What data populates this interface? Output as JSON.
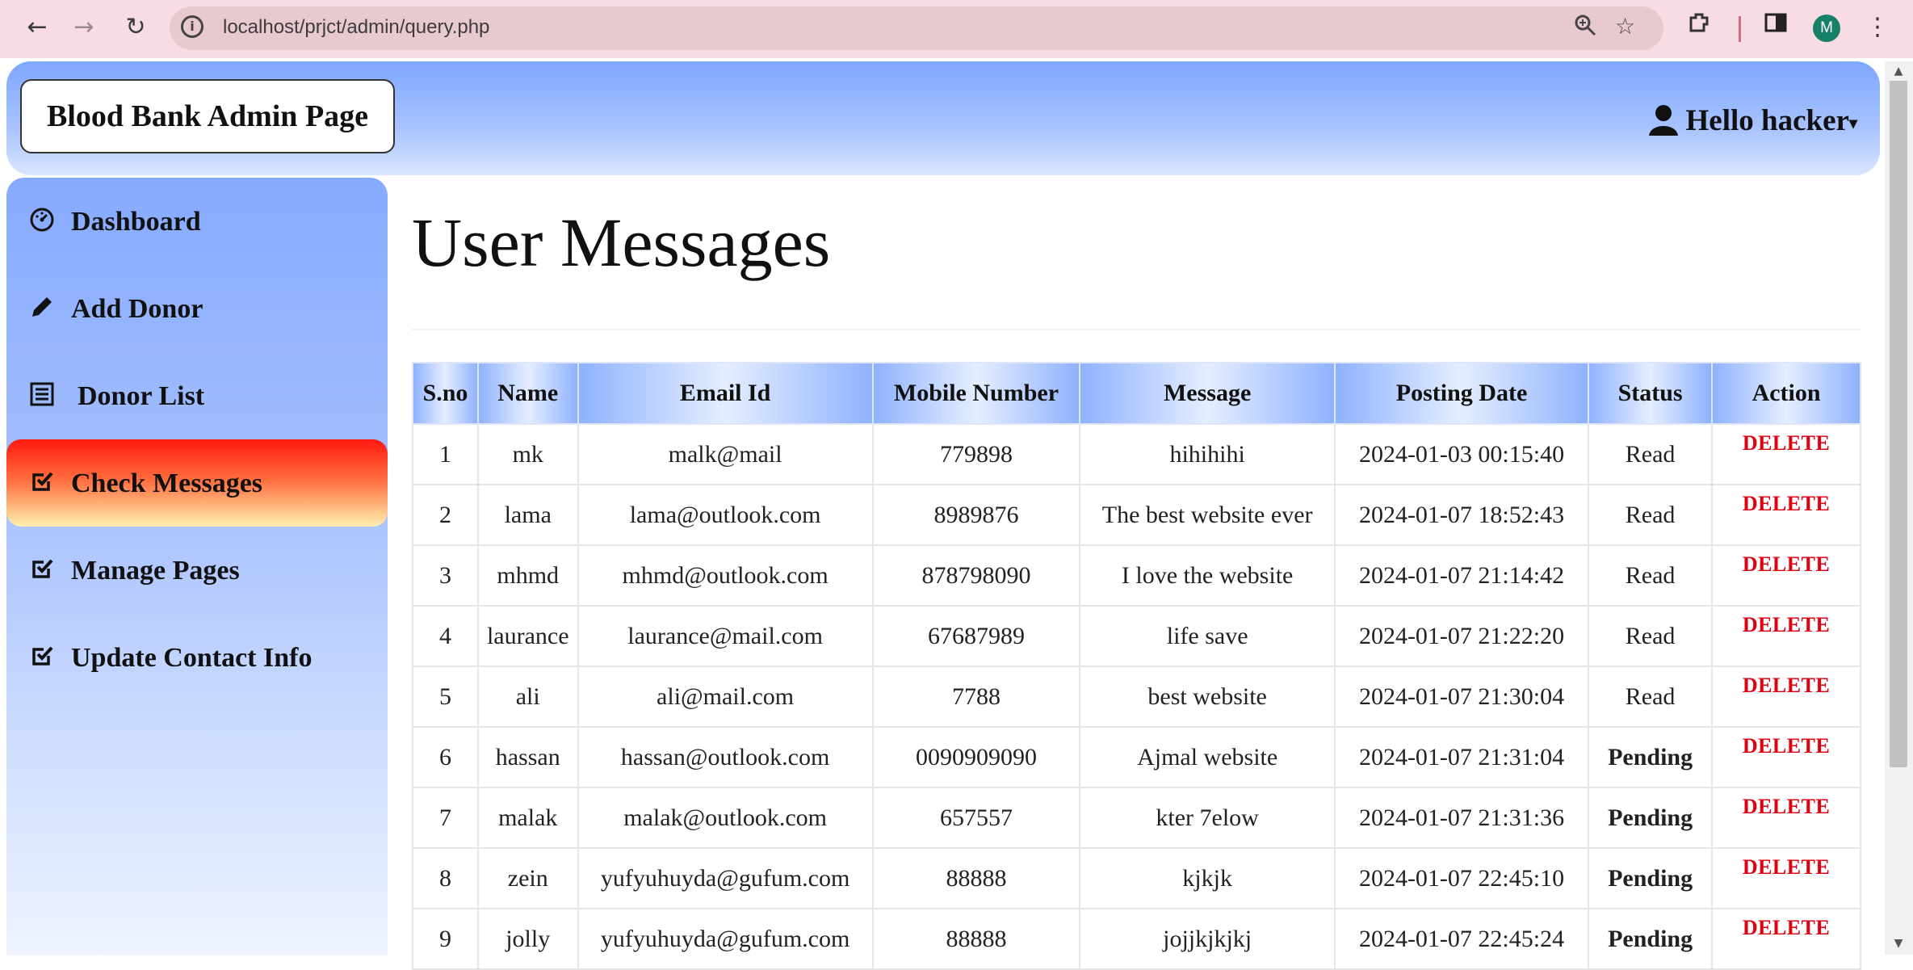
{
  "browser": {
    "url": "localhost/prjct/admin/query.php",
    "avatar_initial": "M"
  },
  "header": {
    "brand": "Blood Bank Admin Page",
    "greeting": "Hello hacker"
  },
  "sidebar": {
    "items": [
      {
        "label": "Dashboard",
        "icon": "dashboard-icon",
        "active": false
      },
      {
        "label": "Add Donor",
        "icon": "pencil-icon",
        "active": false
      },
      {
        "label": "Donor List",
        "icon": "list-icon",
        "active": false
      },
      {
        "label": "Check Messages",
        "icon": "checkbox-edit-icon",
        "active": true
      },
      {
        "label": "Manage Pages",
        "icon": "checkbox-edit-icon",
        "active": false
      },
      {
        "label": "Update Contact Info",
        "icon": "checkbox-edit-icon",
        "active": false
      }
    ]
  },
  "main": {
    "title": "User Messages",
    "columns": [
      "S.no",
      "Name",
      "Email Id",
      "Mobile Number",
      "Message",
      "Posting Date",
      "Status",
      "Action"
    ],
    "action_label": "DELETE",
    "rows": [
      {
        "sno": "1",
        "name": "mk",
        "email": "malk@mail",
        "mobile": "779898",
        "message": "hihihihi",
        "date": "2024-01-03 00:15:40",
        "status": "Read"
      },
      {
        "sno": "2",
        "name": "lama",
        "email": "lama@outlook.com",
        "mobile": "8989876",
        "message": "The best website ever",
        "date": "2024-01-07 18:52:43",
        "status": "Read"
      },
      {
        "sno": "3",
        "name": "mhmd",
        "email": "mhmd@outlook.com",
        "mobile": "878798090",
        "message": "I love the website",
        "date": "2024-01-07 21:14:42",
        "status": "Read"
      },
      {
        "sno": "4",
        "name": "laurance",
        "email": "laurance@mail.com",
        "mobile": "67687989",
        "message": "life save",
        "date": "2024-01-07 21:22:20",
        "status": "Read"
      },
      {
        "sno": "5",
        "name": "ali",
        "email": "ali@mail.com",
        "mobile": "7788",
        "message": "best website",
        "date": "2024-01-07 21:30:04",
        "status": "Read"
      },
      {
        "sno": "6",
        "name": "hassan",
        "email": "hassan@outlook.com",
        "mobile": "0090909090",
        "message": "Ajmal website",
        "date": "2024-01-07 21:31:04",
        "status": "Pending"
      },
      {
        "sno": "7",
        "name": "malak",
        "email": "malak@outlook.com",
        "mobile": "657557",
        "message": "kter 7elow",
        "date": "2024-01-07 21:31:36",
        "status": "Pending"
      },
      {
        "sno": "8",
        "name": "zein",
        "email": "yufyuhuyda@gufum.com",
        "mobile": "88888",
        "message": "kjkjk",
        "date": "2024-01-07 22:45:10",
        "status": "Pending"
      },
      {
        "sno": "9",
        "name": "jolly",
        "email": "yufyuhuyda@gufum.com",
        "mobile": "88888",
        "message": "jojjkjkjkj",
        "date": "2024-01-07 22:45:24",
        "status": "Pending"
      }
    ]
  },
  "colors": {
    "delete": "#e00010",
    "pending": "#3473b3",
    "active_item": "#ff1a10",
    "header_blue": "#7ea7ff"
  }
}
